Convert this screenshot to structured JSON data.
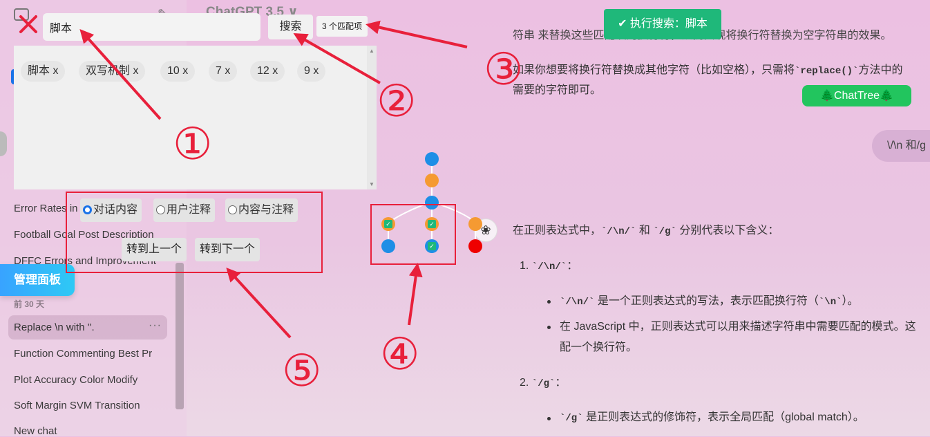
{
  "search": {
    "value": "脚本",
    "button_label": "搜索",
    "match_count": "3 个匹配项",
    "history": [
      "脚本 x",
      "双写机制 x",
      "10 x",
      "7 x",
      "12 x",
      "9 x"
    ],
    "scope_options": [
      "对话内容",
      "用户注释",
      "内容与注释"
    ],
    "selected_scope": "对话内容",
    "prev_label": "转到上一个",
    "next_label": "转到下一个"
  },
  "sidebar": {
    "items": [
      "Error Rates in",
      "Football Goal Post Description",
      "DFFC Errors and Improvement"
    ],
    "admin_button": "管理面板",
    "group_label": "前 30 天",
    "recent": [
      {
        "label": "Replace \\n with ''.",
        "menu": "···"
      },
      {
        "label": "Function Commenting Best Pr"
      },
      {
        "label": "Plot Accuracy Color Modify"
      },
      {
        "label": "Soft Margin SVM Transition"
      },
      {
        "label": "New chat"
      }
    ]
  },
  "header": {
    "title": "ChatGPT 3.5 ∨",
    "toast": "执行搜索：脚本",
    "chattree_label": "🌲ChatTree🌲"
  },
  "chat": {
    "top_line": "符串    来替换这些匹配项的换行符，从而实现将换行符替换为空字符串的效果。",
    "para1_a": "如果你想要将换行符替换成其他字符（比如空格），只需将",
    "para1_code": "`replace()`",
    "para1_b": "方法中的",
    "para2": "需要的字符即可。",
    "user_bubble": "\\/\\n 和/g",
    "intro_a": "在正则表达式中，",
    "intro_code1": "`/\\n/`",
    "intro_mid": "和",
    "intro_code2": "`/g`",
    "intro_b": "分别代表以下含义：",
    "item1_num": "1.",
    "item1_code": "`/\\n/`",
    "item1_colon": "：",
    "b1_code": "`/\\n/`",
    "b1_text": "是一个正则表达式的写法，表示匹配换行符（",
    "b1_code2": "`\\n`",
    "b1_end": "）。",
    "b2_line1": "在 JavaScript 中，正则表达式可以用来描述字符串中需要匹配的模式。这",
    "b2_line2": "配一个换行符。",
    "item2_num": "2.",
    "item2_code": "`/g`",
    "item2_colon": "：",
    "b3_code": "`/g`",
    "b3_text": "是正则表达式的修饰符，表示全局匹配（global match）。"
  },
  "annotations": [
    "①",
    "②",
    "③",
    "④",
    "⑤"
  ],
  "colors": {
    "annotation": "#e8203b",
    "toast": "#1fb87a",
    "chattree": "#22c55e",
    "admin": "#38a3ff"
  }
}
